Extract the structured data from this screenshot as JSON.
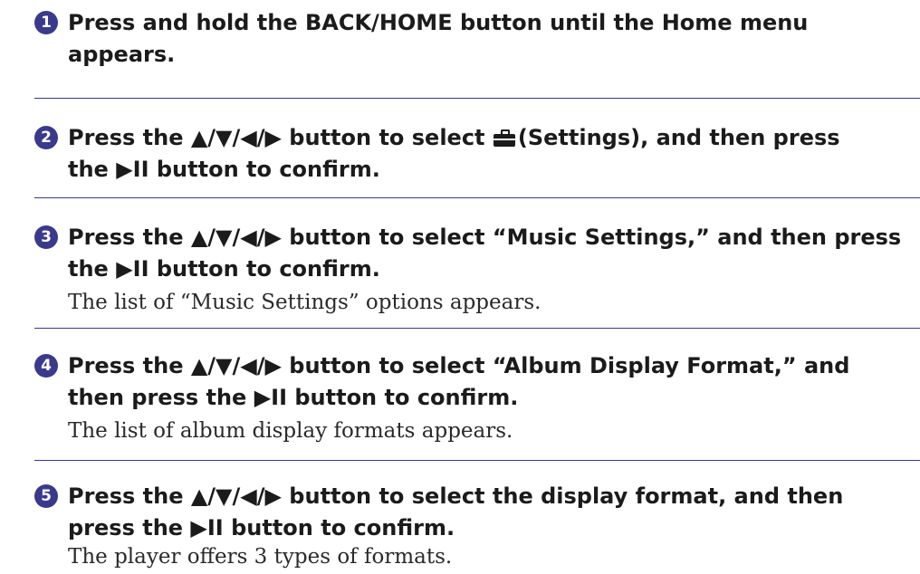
{
  "steps": [
    {
      "number": "1",
      "lines": [
        "Press and hold the BACK/HOME button until the Home menu",
        "appears."
      ]
    },
    {
      "number": "2",
      "line1_before_icon": "Press the ▲/▼/◀/▶ button to select ",
      "line1_after_icon": "(Settings), and then press",
      "icon": "settings-toolbox-icon",
      "line2": "the ▶II button to confirm."
    },
    {
      "number": "3",
      "lines": [
        "Press the ▲/▼/◀/▶ button to select “Music Settings,” and then press",
        "the ▶II button to confirm."
      ],
      "result": "The list of “Music Settings” options appears."
    },
    {
      "number": "4",
      "lines": [
        "Press the ▲/▼/◀/▶ button to select “Album Display Format,” and",
        "then press the ▶II button to confirm."
      ],
      "result": "The list of album display formats appears."
    },
    {
      "number": "5",
      "lines": [
        "Press the ▲/▼/◀/▶ button to select the display format, and then",
        "press the ▶II button to confirm."
      ],
      "result": "The player offers 3 types of formats."
    }
  ],
  "colors": {
    "accent": "#3a3a8c",
    "text": "#1b1b1b"
  }
}
